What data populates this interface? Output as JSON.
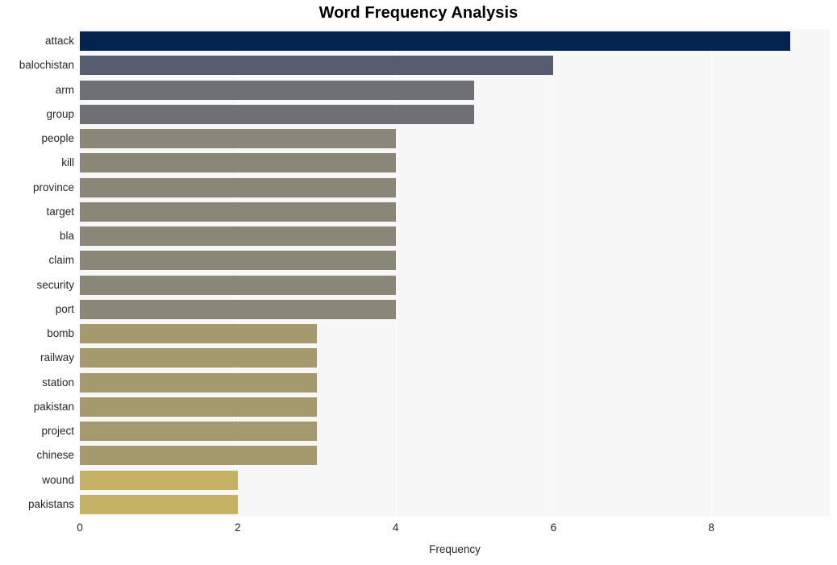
{
  "chart_data": {
    "type": "bar",
    "orientation": "horizontal",
    "title": "Word Frequency Analysis",
    "xlabel": "Frequency",
    "ylabel": "",
    "categories": [
      "attack",
      "balochistan",
      "arm",
      "group",
      "people",
      "kill",
      "province",
      "target",
      "bla",
      "claim",
      "security",
      "port",
      "bomb",
      "railway",
      "station",
      "pakistan",
      "project",
      "chinese",
      "wound",
      "pakistans"
    ],
    "values": [
      9,
      6,
      5,
      5,
      4,
      4,
      4,
      4,
      4,
      4,
      4,
      4,
      3,
      3,
      3,
      3,
      3,
      3,
      2,
      2
    ],
    "bar_colors": [
      "#042450",
      "#575d70",
      "#6f7073",
      "#6f7073",
      "#8a8779",
      "#8a8779",
      "#8a8779",
      "#8a8779",
      "#8a8779",
      "#8a8779",
      "#8a8779",
      "#8a8779",
      "#a49a6e",
      "#a49a6e",
      "#a49a6e",
      "#a49a6e",
      "#a49a6e",
      "#a49a6e",
      "#c5b264",
      "#c5b264"
    ],
    "xticks": [
      "0",
      "2",
      "4",
      "6",
      "8"
    ],
    "xtick_values": [
      0,
      2,
      4,
      6,
      8
    ],
    "xlim": [
      0,
      9.5
    ],
    "grid": true,
    "grid_color": "#ffffff",
    "plot_background": "#f7f7f7",
    "figure_background": "#ffffff",
    "legend": null
  }
}
